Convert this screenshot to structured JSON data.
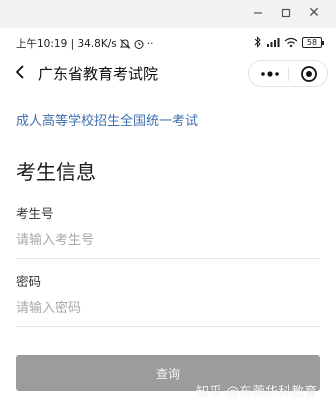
{
  "status_bar": {
    "time_speed": "上午10:19 | 34.8K/s",
    "battery": "58"
  },
  "nav": {
    "title": "广东省教育考试院"
  },
  "link_text": "成人高等学校招生全国统一考试",
  "section_title": "考生信息",
  "form": {
    "exam_id": {
      "label": "考生号",
      "placeholder": "请输入考生号"
    },
    "password": {
      "label": "密码",
      "placeholder": "请输入密码"
    }
  },
  "query_button": "查询",
  "watermark": "知乎 @东莞华科教育",
  "icons": [
    "minimize-icon",
    "maximize-icon",
    "close-icon",
    "mute-icon",
    "alarm-icon",
    "more-dots-icon",
    "bluetooth-icon",
    "signal-icon",
    "wifi-icon",
    "battery-icon",
    "back-arrow-icon",
    "menu-dots-icon",
    "target-icon"
  ]
}
